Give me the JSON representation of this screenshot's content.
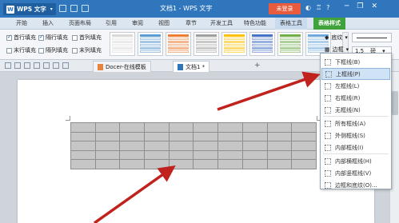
{
  "titlebar": {
    "app_label": "WPS 文字",
    "app_logo": "W",
    "doc_title": "文档1 - WPS 文字",
    "login_label": "未登录",
    "min_icon": "─",
    "restore_icon": "❐",
    "close_icon": "✕"
  },
  "menu": {
    "tabs": [
      "开始",
      "插入",
      "页面布局",
      "引用",
      "审阅",
      "视图",
      "章节",
      "开发工具",
      "特色功能",
      "表格工具"
    ],
    "active_tab": "表格样式"
  },
  "ribbon": {
    "checkboxes": [
      {
        "label": "首行填充",
        "checked": true
      },
      {
        "label": "隔行填充",
        "checked": true
      },
      {
        "label": "首列填充",
        "checked": false
      },
      {
        "label": "末行填充",
        "checked": false
      },
      {
        "label": "隔列填充",
        "checked": false
      },
      {
        "label": "末列填充",
        "checked": false
      }
    ],
    "swatch_colors": [
      "#d9d9d9",
      "#5b9bd5",
      "#ed7d31",
      "#9e9e9e",
      "#ffc000",
      "#4472c4",
      "#70ad47",
      "#6fa8dc"
    ],
    "shading_label": "底纹",
    "border_label": "边框",
    "pen_size": "1.5",
    "pen_unit": "磅"
  },
  "docbar": {
    "tabs": [
      {
        "label": "Docer-在线模板",
        "active": false
      },
      {
        "label": "文档1 *",
        "active": true
      }
    ],
    "add_label": "+"
  },
  "dropdown": {
    "items": [
      {
        "label": "下框线(B)",
        "highlighted": false
      },
      {
        "label": "上框线(P)",
        "highlighted": true
      },
      {
        "label": "左框线(L)",
        "highlighted": false
      },
      {
        "label": "右框线(R)",
        "highlighted": false
      },
      {
        "label": "无框线(N)",
        "highlighted": false
      },
      {
        "label": "所有框线(A)",
        "highlighted": false
      },
      {
        "label": "外侧框线(S)",
        "highlighted": false
      },
      {
        "label": "内部框线(I)",
        "highlighted": false
      },
      {
        "label": "内部横框线(H)",
        "highlighted": false
      },
      {
        "label": "内部竖框线(V)",
        "highlighted": false
      },
      {
        "label": "边框和底纹(O)...",
        "highlighted": false
      }
    ]
  },
  "table": {
    "rows": 5,
    "cols": 10
  },
  "accent_colors": {
    "title": "#2f76bd",
    "active_tab": "#3fa23a",
    "login": "#e85b3c",
    "arrow": "#c0221e"
  }
}
